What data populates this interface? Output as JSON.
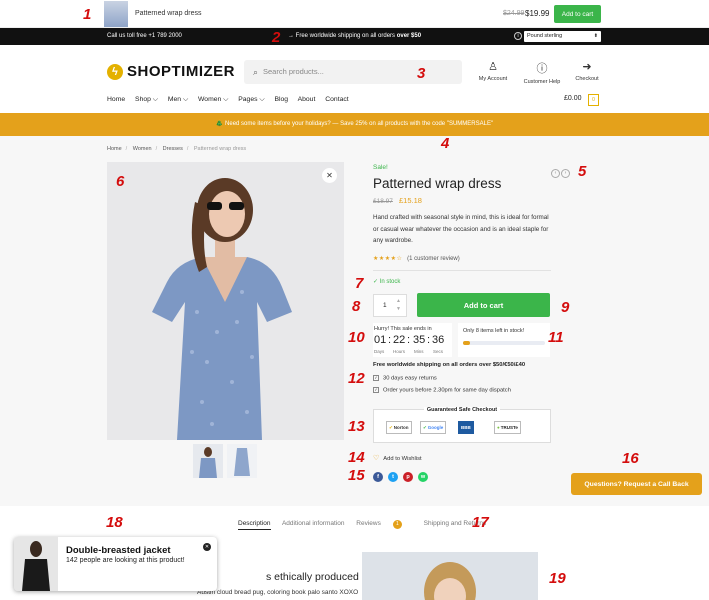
{
  "sticky": {
    "product_name": "Patterned wrap dress",
    "old_price": "$24.99",
    "new_price": "$19.99",
    "add_to_cart": "Add to cart"
  },
  "topbar": {
    "phone": "Call us toll free +1 789 2000",
    "shipping_prefix": "→ Free worldwide shipping on all orders ",
    "shipping_bold": "over $50",
    "currency": "Pound sterling"
  },
  "header": {
    "logo": "SHOPTIMIZER",
    "search_placeholder": "Search products...",
    "account": "My Account",
    "help": "Customer Help",
    "checkout": "Checkout"
  },
  "nav": {
    "items": [
      "Home",
      "Shop ⌵",
      "Men ⌵",
      "Women ⌵",
      "Pages ⌵",
      "Blog",
      "About",
      "Contact"
    ],
    "cart_total": "£0.00",
    "cart_count": "0"
  },
  "promo": {
    "text": "🎄 Need some items before your holidays? — Save 25% on all products with the code \"SUMMERSALE\""
  },
  "breadcrumb": {
    "items": [
      "Home",
      "Women",
      "Dresses",
      "Patterned wrap dress"
    ]
  },
  "product": {
    "sale": "Sale!",
    "title": "Patterned wrap dress",
    "old_price": "£18.97",
    "new_price": "£15.18",
    "description": "Hand crafted with seasonal style in mind, this is ideal for formal or casual wear whatever the occasion and is an ideal staple for any wardrobe.",
    "stars": "★★★★☆",
    "review_text": "(1 customer review)",
    "stock": "✓  In stock",
    "qty": "1",
    "add_to_cart": "Add to cart",
    "hurry": "Hurry! This sale ends in",
    "timer": {
      "days": "01",
      "hours": "22",
      "mins": "35",
      "secs": "36"
    },
    "timer_labels": {
      "days": "Days",
      "hours": "Hours",
      "mins": "Mins",
      "secs": "Secs"
    },
    "items_left": "Only 8 items left in stock!",
    "stock_level_percent": 8,
    "free_shipping": "Free worldwide shipping on all orders over $50/€50/£40",
    "benefits": [
      "30 days easy returns",
      "Order yours before 2.30pm for same day dispatch"
    ],
    "safe_checkout": "Guaranteed Safe Checkout",
    "badges": [
      "Norton",
      "Google",
      "BBB",
      "TRUSTe"
    ],
    "wishlist": "Add to Wishlist",
    "social": [
      "f",
      "t",
      "p",
      "w"
    ],
    "callback": "Questions? Request a Call Back"
  },
  "tabs": {
    "description": "Description",
    "additional": "Additional information",
    "reviews": "Reviews",
    "reviews_count": "1",
    "shipping": "Shipping and Returns"
  },
  "content": {
    "heading_partial": "s ethically produced",
    "body_partial": "Austin cloud bread pug, coloring book palo santo XOXO"
  },
  "popup": {
    "name": "Double-breasted jacket",
    "message": "142 people are looking at this product!"
  },
  "annotations": [
    "1",
    "2",
    "3",
    "4",
    "5",
    "6",
    "7",
    "8",
    "9",
    "10",
    "11",
    "12",
    "13",
    "14",
    "15",
    "16",
    "17",
    "18",
    "19"
  ],
  "colors": {
    "green": "#3bb54a",
    "orange": "#e4a11b",
    "logo": "#e4b100",
    "black": "#111111"
  }
}
